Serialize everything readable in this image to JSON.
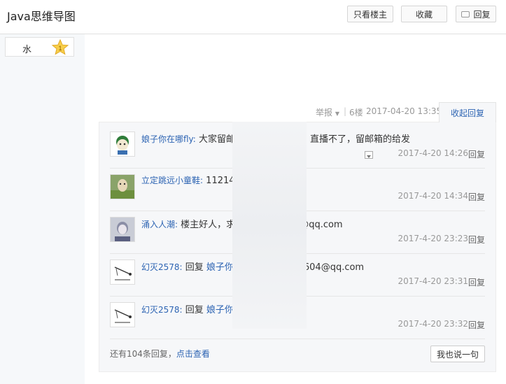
{
  "header": {
    "title": "Java思维导图",
    "buttons": {
      "only_op": "只看楼主",
      "favorite": "收藏",
      "reply": "回复"
    }
  },
  "sidebar": {
    "badge_label": "水",
    "badge_level": "1"
  },
  "post_meta": {
    "report": "举报",
    "floor": "6楼",
    "datetime": "2017-04-20 13:35",
    "collapse": "收起回复"
  },
  "replies": [
    {
      "user": "娘子你在哪fly:",
      "parts": [
        {
          "t": " 大家留邮"
        },
        {
          "t": "厉害，直播不了，留邮箱的给发"
        }
      ],
      "time": "2017-4-20 14:26",
      "reply": "回复"
    },
    {
      "user": "立定跳远小童鞋:",
      "parts": [
        {
          "t": " 11214"
        }
      ],
      "time": "2017-4-20 14:34",
      "reply": "回复"
    },
    {
      "user": "涌入人潮:",
      "parts": [
        {
          "t": " 楼主好人，求"
        },
        {
          "t": "@qq.com"
        }
      ],
      "time": "2017-4-20 23:23",
      "reply": "回复"
    },
    {
      "user": "幻灭2578:",
      "parts": [
        {
          "t": " 回复 "
        },
        {
          "t": "娘子你",
          "link": true
        },
        {
          "t": "604@qq.com"
        }
      ],
      "time": "2017-4-20 23:31",
      "reply": "回复"
    },
    {
      "user": "幻灭2578:",
      "parts": [
        {
          "t": " 回复 "
        },
        {
          "t": "娘子你",
          "link": true
        }
      ],
      "time": "2017-4-20 23:32",
      "reply": "回复"
    }
  ],
  "footer": {
    "more_prefix": "还有104条回复，",
    "more_link": "点击查看",
    "say_button": "我也说一句"
  },
  "colors": {
    "link": "#2d64b3",
    "muted": "#999999",
    "panel": "#f6f7f9"
  }
}
